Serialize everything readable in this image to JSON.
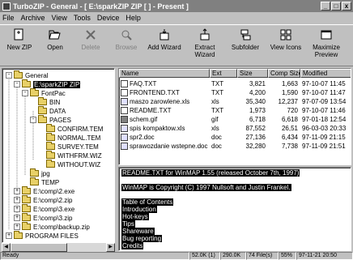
{
  "window": {
    "title": "TurboZIP - General - [ E:\\sparkZIP ZIP [ ] - Present ]",
    "controls": [
      "_",
      "□",
      "x"
    ]
  },
  "menu": [
    "File",
    "Archive",
    "View",
    "Tools",
    "Device",
    "Help"
  ],
  "toolbar": [
    {
      "label": "New ZIP",
      "icon": "new-zip-icon",
      "enabled": true
    },
    {
      "label": "Open",
      "icon": "open-icon",
      "enabled": true
    },
    {
      "label": "Delete",
      "icon": "delete-icon",
      "enabled": false
    },
    {
      "label": "Browse",
      "icon": "browse-icon",
      "enabled": false
    },
    {
      "label": "Add Wizard",
      "icon": "add-wizard-icon",
      "enabled": true
    },
    {
      "label": "Extract Wizard",
      "icon": "extract-wizard-icon",
      "enabled": true
    },
    {
      "label": "Subfolder",
      "icon": "subfolder-icon",
      "enabled": true
    },
    {
      "label": "View Icons",
      "icon": "view-icons-icon",
      "enabled": true
    },
    {
      "label": "Maximize Preview",
      "icon": "maximize-preview-icon",
      "enabled": true
    }
  ],
  "tree": [
    {
      "label": "General",
      "indent": 0,
      "expander": "-",
      "kind": "folder"
    },
    {
      "label": "E:\\sparkZIP ZIP",
      "indent": 1,
      "expander": "-",
      "kind": "folder",
      "selected": true
    },
    {
      "label": "FontPac",
      "indent": 2,
      "expander": "-",
      "kind": "folder"
    },
    {
      "label": "BIN",
      "indent": 3,
      "expander": "",
      "kind": "folder"
    },
    {
      "label": "DATA",
      "indent": 3,
      "expander": "",
      "kind": "folder"
    },
    {
      "label": "PAGES",
      "indent": 3,
      "expander": "-",
      "kind": "folder"
    },
    {
      "label": "CONFIRM.TEM",
      "indent": 4,
      "expander": "",
      "kind": "folder"
    },
    {
      "label": "NORMAL.TEM",
      "indent": 4,
      "expander": "",
      "kind": "folder"
    },
    {
      "label": "SURVEY.TEM",
      "indent": 4,
      "expander": "",
      "kind": "folder"
    },
    {
      "label": "WITHFRM.WIZ",
      "indent": 4,
      "expander": "",
      "kind": "folder"
    },
    {
      "label": "WITHOUT.WIZ",
      "indent": 4,
      "expander": "",
      "kind": "folder"
    },
    {
      "label": "jpg",
      "indent": 2,
      "expander": "",
      "kind": "folder"
    },
    {
      "label": "TEMP",
      "indent": 2,
      "expander": "",
      "kind": "folder"
    },
    {
      "label": "E:\\comp\\2.exe",
      "indent": 1,
      "expander": "+",
      "kind": "folder"
    },
    {
      "label": "E:\\comp\\2.zip",
      "indent": 1,
      "expander": "+",
      "kind": "folder"
    },
    {
      "label": "E:\\comp\\3.exe",
      "indent": 1,
      "expander": "+",
      "kind": "folder"
    },
    {
      "label": "E:\\comp\\3.zip",
      "indent": 1,
      "expander": "+",
      "kind": "folder"
    },
    {
      "label": "E:\\comp\\backup.zip",
      "indent": 1,
      "expander": "+",
      "kind": "folder"
    },
    {
      "label": "PROGRAM FILES",
      "indent": 0,
      "expander": "+",
      "kind": "folder"
    }
  ],
  "file_list": {
    "columns": [
      "Name",
      "Ext",
      "Size",
      "Comp Size",
      "Modified"
    ],
    "rows": [
      {
        "name": "FAQ.TXT",
        "ext": "TXT",
        "size": "3,821",
        "comp": "1,663",
        "modified": "97-10-07 11:45",
        "icon": "text"
      },
      {
        "name": "FRONTEND.TXT",
        "ext": "TXT",
        "size": "4,200",
        "comp": "1,590",
        "modified": "97-10-07 11:47",
        "icon": "text"
      },
      {
        "name": "maszo zarowlene.xls",
        "ext": "xls",
        "size": "35,340",
        "comp": "12,237",
        "modified": "97-07-09 13:54",
        "icon": "doc"
      },
      {
        "name": "README.TXT",
        "ext": "TXT",
        "size": "1,973",
        "comp": "720",
        "modified": "97-10-07 11:46",
        "icon": "text"
      },
      {
        "name": "schem.gif",
        "ext": "gif",
        "size": "6,718",
        "comp": "6,618",
        "modified": "97-01-18 12:54",
        "icon": "doc"
      },
      {
        "name": "spis kompaktow.xls",
        "ext": "xls",
        "size": "87,552",
        "comp": "26,51",
        "modified": "96-03-03 20:33",
        "icon": "doc"
      },
      {
        "name": "spr2.doc",
        "ext": "doc",
        "size": "27,136",
        "comp": "6,434",
        "modified": "97-11-09 21:15",
        "icon": "doc"
      },
      {
        "name": "sprawozdanie wstepne.doc",
        "ext": "doc",
        "size": "32,280",
        "comp": "7,738",
        "modified": "97-11-09 21:51",
        "icon": "doc"
      }
    ]
  },
  "viewer": {
    "lines": [
      {
        "text": "README.TXT for WinMAP 1.55 (released October 7th, 1997)",
        "highlight": true
      },
      {
        "text": "",
        "highlight": false
      },
      {
        "text": "WinMAP is Copyright (C) 1997 Nullsoft and Justin Frankel.",
        "highlight": true
      },
      {
        "text": "",
        "highlight": false
      },
      {
        "text": "Table of Contents",
        "highlight": true
      },
      {
        "text": "  Introduction",
        "highlight": true
      },
      {
        "text": "  Hot-keys",
        "highlight": true
      },
      {
        "text": "  Tips",
        "highlight": true
      },
      {
        "text": "  Shareware",
        "highlight": true
      },
      {
        "text": "  Bug reporting",
        "highlight": true
      },
      {
        "text": "  Credits",
        "highlight": true
      }
    ]
  },
  "status": {
    "state": "Ready",
    "panels": [
      "52.0K (1)",
      "290.0K",
      "74 File(s)",
      "55%",
      "97-11-21 20:50"
    ]
  }
}
